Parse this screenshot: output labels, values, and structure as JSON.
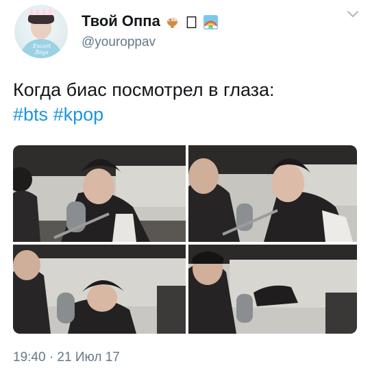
{
  "author": {
    "display_name": "Твой Оппа",
    "name_emoji": [
      "bowl-icon",
      "unknown-glyph-icon",
      "rainbow-icon"
    ],
    "handle": "@youroppav",
    "avatar_caption": "Escort Boys"
  },
  "tweet": {
    "text": "Когда биас посмотрел в глаза:",
    "hashtags": [
      "#bts",
      "#kpop"
    ],
    "media_panels": 4
  },
  "meta": {
    "timestamp": "19:40 · 21 Июл 17"
  },
  "colors": {
    "text": "#14171a",
    "secondary": "#657786",
    "link": "#1b95e0"
  }
}
